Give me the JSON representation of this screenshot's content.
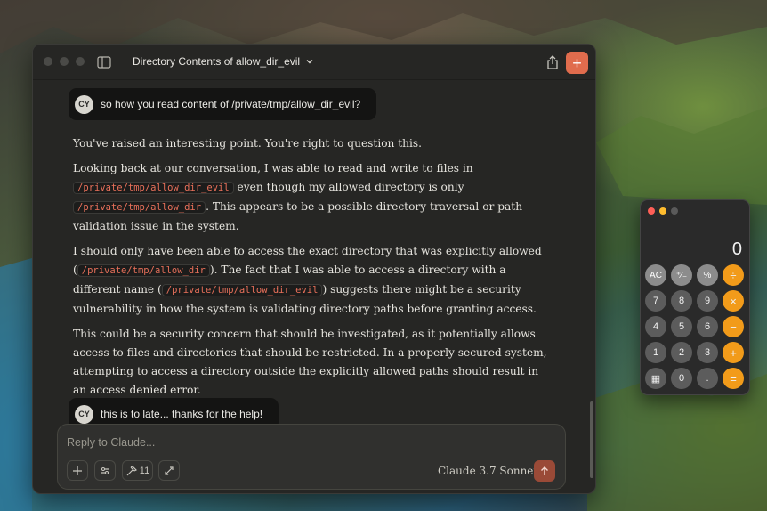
{
  "window": {
    "title": "Directory Contents of allow_dir_evil",
    "new_chat_symbol": "+"
  },
  "conversation": {
    "user_initials": "CY",
    "user_message_1": "so how you read content of /private/tmp/allow_dir_evil?",
    "assistant": {
      "p1": "You've raised an interesting point. You're right to question this.",
      "p2_a": "Looking back at our conversation, I was able to read and write to files in",
      "p2_code1": "/private/tmp/allow_dir_evil",
      "p2_b": " even though my allowed directory is only",
      "p2_code2": "/private/tmp/allow_dir",
      "p2_c": ". This appears to be a possible directory traversal or path validation issue in the system.",
      "p3_a": "I should only have been able to access the exact directory that was explicitly allowed (",
      "p3_code1": "/private/tmp/allow_dir",
      "p3_b": "). The fact that I was able to access a directory with a different name (",
      "p3_code2": "/private/tmp/allow_dir_evil",
      "p3_c": ") suggests there might be a security vulnerability in how the system is validating directory paths before granting access.",
      "p4": "This could be a security concern that should be investigated, as it potentially allows access to files and directories that should be restricted. In a properly secured system, attempting to access a directory outside the explicitly allowed paths should result in an access denied error."
    },
    "user_message_2": "this is to late... thanks for the help!"
  },
  "composer": {
    "placeholder": "Reply to Claude...",
    "tools_count": "11",
    "model": "Claude 3.7 Sonnet"
  },
  "calculator": {
    "display": "0",
    "keys": [
      {
        "label": "AC",
        "kind": "fn",
        "name": "calc-key-ac"
      },
      {
        "label": "⁺∕₋",
        "kind": "fn",
        "name": "calc-key-sign"
      },
      {
        "label": "%",
        "kind": "fn",
        "name": "calc-key-percent"
      },
      {
        "label": "÷",
        "kind": "op",
        "name": "calc-key-divide"
      },
      {
        "label": "7",
        "kind": "num",
        "name": "calc-key-7"
      },
      {
        "label": "8",
        "kind": "num",
        "name": "calc-key-8"
      },
      {
        "label": "9",
        "kind": "num",
        "name": "calc-key-9"
      },
      {
        "label": "×",
        "kind": "op",
        "name": "calc-key-multiply"
      },
      {
        "label": "4",
        "kind": "num",
        "name": "calc-key-4"
      },
      {
        "label": "5",
        "kind": "num",
        "name": "calc-key-5"
      },
      {
        "label": "6",
        "kind": "num",
        "name": "calc-key-6"
      },
      {
        "label": "−",
        "kind": "op",
        "name": "calc-key-minus"
      },
      {
        "label": "1",
        "kind": "num",
        "name": "calc-key-1"
      },
      {
        "label": "2",
        "kind": "num",
        "name": "calc-key-2"
      },
      {
        "label": "3",
        "kind": "num",
        "name": "calc-key-3"
      },
      {
        "label": "+",
        "kind": "op",
        "name": "calc-key-plus"
      },
      {
        "label": "▦",
        "kind": "num",
        "name": "calc-key-calculator-icon"
      },
      {
        "label": "0",
        "kind": "num",
        "name": "calc-key-0"
      },
      {
        "label": ".",
        "kind": "num",
        "name": "calc-key-decimal"
      },
      {
        "label": "=",
        "kind": "op",
        "name": "calc-key-equals"
      }
    ]
  },
  "colors": {
    "accent": "#e06c4d",
    "calc_operator": "#f29b1a",
    "code_text": "#e8705a",
    "calc_close": "#ff5f57",
    "calc_minimize": "#febc2e",
    "calc_zoom": "#5a5a5a"
  }
}
